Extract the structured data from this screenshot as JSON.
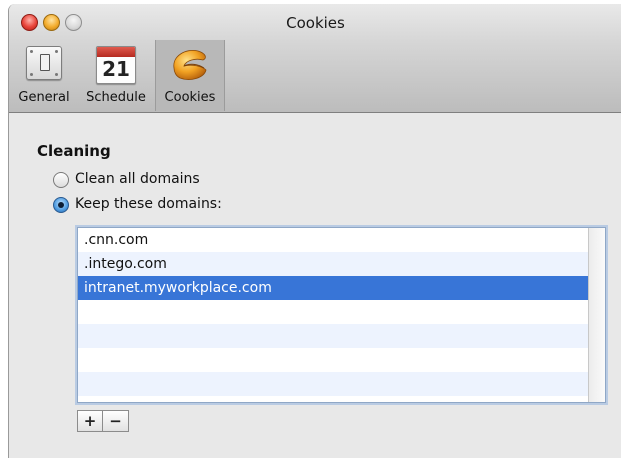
{
  "window": {
    "title": "Cookies"
  },
  "toolbar": {
    "items": [
      {
        "label": "General",
        "icon": "switch-plate-icon"
      },
      {
        "label": "Schedule",
        "icon": "calendar-icon",
        "calendar_day": "21"
      },
      {
        "label": "Cookies",
        "icon": "fortune-cookie-icon",
        "selected": true
      }
    ]
  },
  "cleaning": {
    "title": "Cleaning",
    "options": [
      {
        "label": "Clean all domains",
        "selected": false
      },
      {
        "label": "Keep these domains:",
        "selected": true
      }
    ]
  },
  "domains": {
    "rows": [
      ".cnn.com",
      ".intego.com",
      "intranet.myworkplace.com",
      "",
      "",
      "",
      ""
    ],
    "selected_index": 2
  },
  "buttons": {
    "add": "+",
    "remove": "−"
  },
  "colors": {
    "selection": "#3875d7",
    "alt_row": "#edf3fe"
  }
}
